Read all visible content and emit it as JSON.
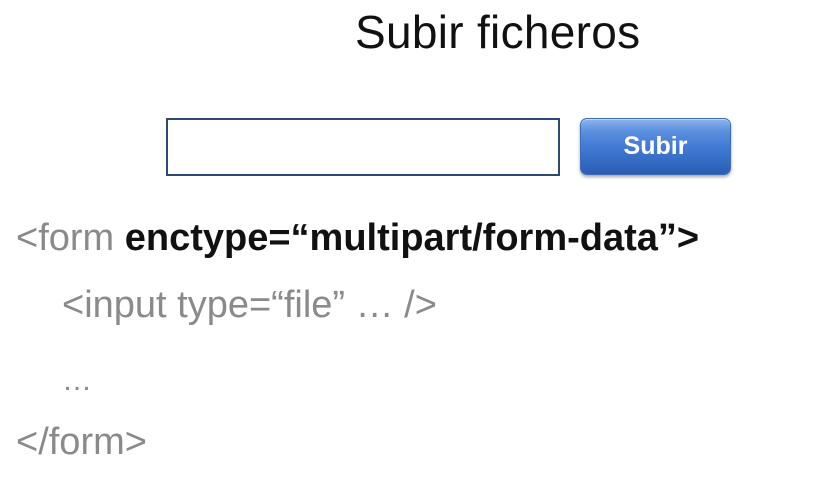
{
  "slide": {
    "title": "Subir ficheros",
    "upload_button_label": "Subir",
    "code": {
      "line1_prefix": "<form ",
      "line1_bold": "enctype=“multipart/form-data”>",
      "line2": "<input type=“file” … />",
      "line3": "…",
      "line4": "</form>"
    }
  },
  "colors": {
    "title_text": "#111111",
    "code_text": "#8a8a8a",
    "file_box_border": "#2c4a72",
    "button_blue": "#3f78d2"
  }
}
